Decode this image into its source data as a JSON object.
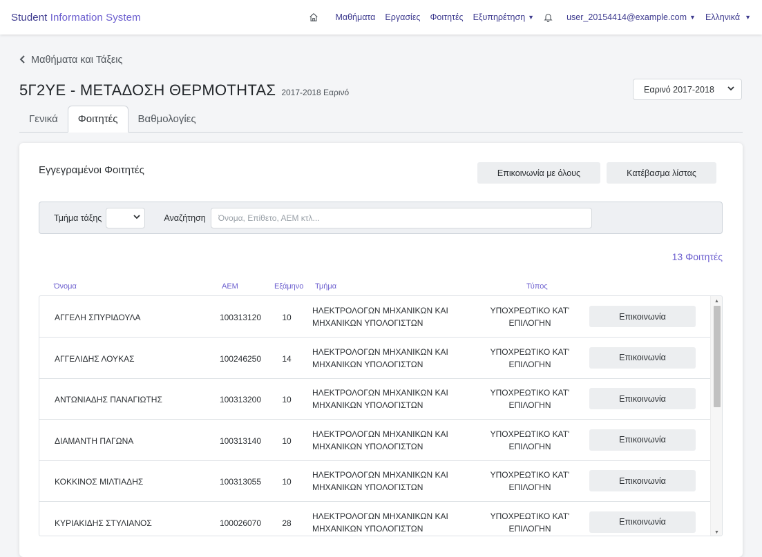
{
  "navbar": {
    "brand_primary": "Student",
    "brand_secondary": "Information System",
    "links": [
      "Μαθήματα",
      "Εργασίες",
      "Φοιτητές"
    ],
    "services_label": "Εξυπηρέτηση",
    "user_email": "user_20154414@example.com",
    "language": "Ελληνικά"
  },
  "header": {
    "back_label": "Μαθήματα και Τάξεις",
    "course_code_title": "5Γ2ΥΕ - ΜΕΤΑΔΟΣΗ ΘΕΡΜΟΤΗΤΑΣ",
    "course_term": "2017-2018 Εαρινό",
    "term_selector": "Εαρινό 2017-2018"
  },
  "tabs": [
    {
      "label": "Γενικά",
      "active": false
    },
    {
      "label": "Φοιτητές",
      "active": true
    },
    {
      "label": "Βαθμολογίες",
      "active": false
    }
  ],
  "students_card": {
    "title": "Εγγεγραμένοι Φοιτητές",
    "contact_all_label": "Επικοινωνία με όλους",
    "download_list_label": "Κατέβασμα λίστας",
    "section_filter_label": "Τμήμα τάξης",
    "section_filter_value": "",
    "search_label": "Αναζήτηση",
    "search_placeholder": "Όνομα, Επίθετο, ΑΕΜ κτλ...",
    "search_value": "",
    "count_label": "13 Φοιτητές"
  },
  "table": {
    "headers": {
      "name": "Όνομα",
      "aem": "ΑΕΜ",
      "semester": "Εξάμηνο",
      "department": "Τμήμα",
      "type": "Τύπος"
    },
    "rows": [
      {
        "name": "ΑΓΓΕΛΗ ΣΠΥΡΙΔΟΥΛΑ",
        "aem": "100313120",
        "semester": "10",
        "department_line1": "ΗΛΕΚΤΡΟΛΟΓΩΝ ΜΗΧΑΝΙΚΩΝ ΚΑΙ",
        "department_line2": "ΜΗΧΑΝΙΚΩΝ ΥΠΟΛΟΓΙΣΤΩΝ",
        "type_line1": "ΥΠΟΧΡΕΩΤΙΚΟ ΚΑΤ'",
        "type_line2": "ΕΠΙΛΟΓΗΝ",
        "action": "Επικοινωνία"
      },
      {
        "name": "ΑΓΓΕΛΙΔΗΣ ΛΟΥΚΑΣ",
        "aem": "100246250",
        "semester": "14",
        "department_line1": "ΗΛΕΚΤΡΟΛΟΓΩΝ ΜΗΧΑΝΙΚΩΝ ΚΑΙ",
        "department_line2": "ΜΗΧΑΝΙΚΩΝ ΥΠΟΛΟΓΙΣΤΩΝ",
        "type_line1": "ΥΠΟΧΡΕΩΤΙΚΟ ΚΑΤ'",
        "type_line2": "ΕΠΙΛΟΓΗΝ",
        "action": "Επικοινωνία"
      },
      {
        "name": "ΑΝΤΩΝΙΑΔΗΣ ΠΑΝΑΓΙΩΤΗΣ",
        "aem": "100313200",
        "semester": "10",
        "department_line1": "ΗΛΕΚΤΡΟΛΟΓΩΝ ΜΗΧΑΝΙΚΩΝ ΚΑΙ",
        "department_line2": "ΜΗΧΑΝΙΚΩΝ ΥΠΟΛΟΓΙΣΤΩΝ",
        "type_line1": "ΥΠΟΧΡΕΩΤΙΚΟ ΚΑΤ'",
        "type_line2": "ΕΠΙΛΟΓΗΝ",
        "action": "Επικοινωνία"
      },
      {
        "name": "ΔΙΑΜΑΝΤΗ ΠΑΓΩΝΑ",
        "aem": "100313140",
        "semester": "10",
        "department_line1": "ΗΛΕΚΤΡΟΛΟΓΩΝ ΜΗΧΑΝΙΚΩΝ ΚΑΙ",
        "department_line2": "ΜΗΧΑΝΙΚΩΝ ΥΠΟΛΟΓΙΣΤΩΝ",
        "type_line1": "ΥΠΟΧΡΕΩΤΙΚΟ ΚΑΤ'",
        "type_line2": "ΕΠΙΛΟΓΗΝ",
        "action": "Επικοινωνία"
      },
      {
        "name": "ΚΟΚΚΙΝΟΣ ΜΙΛΤΙΑΔΗΣ",
        "aem": "100313055",
        "semester": "10",
        "department_line1": "ΗΛΕΚΤΡΟΛΟΓΩΝ ΜΗΧΑΝΙΚΩΝ ΚΑΙ",
        "department_line2": "ΜΗΧΑΝΙΚΩΝ ΥΠΟΛΟΓΙΣΤΩΝ",
        "type_line1": "ΥΠΟΧΡΕΩΤΙΚΟ ΚΑΤ'",
        "type_line2": "ΕΠΙΛΟΓΗΝ",
        "action": "Επικοινωνία"
      },
      {
        "name": "ΚΥΡΙΑΚΙΔΗΣ ΣΤΥΛΙΑΝΟΣ",
        "aem": "100026070",
        "semester": "28",
        "department_line1": "ΗΛΕΚΤΡΟΛΟΓΩΝ ΜΗΧΑΝΙΚΩΝ ΚΑΙ",
        "department_line2": "ΜΗΧΑΝΙΚΩΝ ΥΠΟΛΟΓΙΣΤΩΝ",
        "type_line1": "ΥΠΟΧΡΕΩΤΙΚΟ ΚΑΤ'",
        "type_line2": "ΕΠΙΛΟΓΗΝ",
        "action": "Επικοινωνία"
      }
    ]
  },
  "icons": {
    "home": "home-icon",
    "bell": "bell-icon",
    "back": "chevron-left-icon",
    "dropdown": "chevron-down-icon"
  },
  "colors": {
    "brand": "#3e3b8f",
    "accent": "#6c5fcf",
    "button_bg": "#eceef0"
  }
}
